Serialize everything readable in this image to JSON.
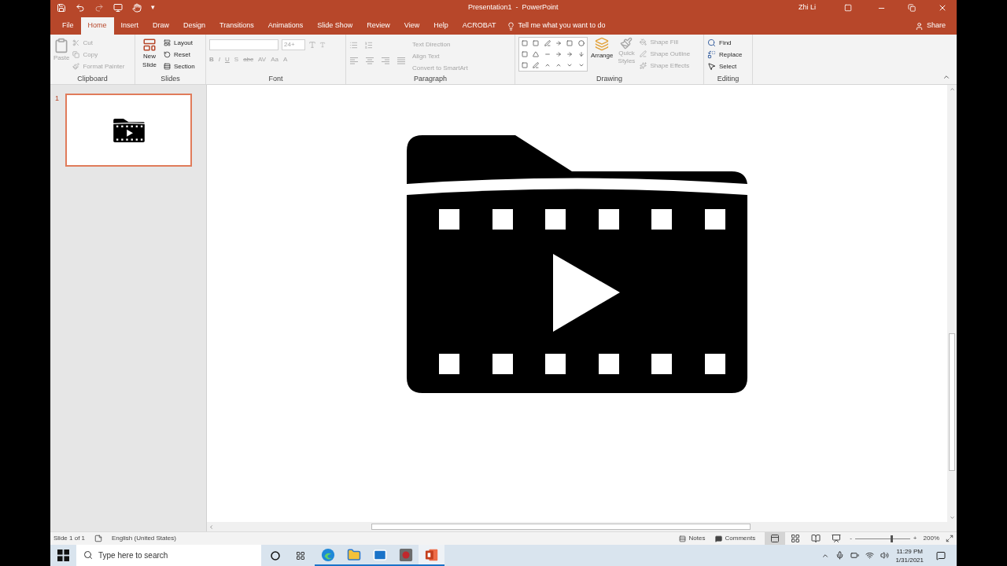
{
  "title_bar": {
    "customize": "▾",
    "title": "Presentation1  -  PowerPoint",
    "user": "Zhi Li"
  },
  "tabs": [
    {
      "label": "File",
      "selected": false
    },
    {
      "label": "Home",
      "selected": true
    },
    {
      "label": "Insert",
      "selected": false
    },
    {
      "label": "Draw",
      "selected": false
    },
    {
      "label": "Design",
      "selected": false
    },
    {
      "label": "Transitions",
      "selected": false
    },
    {
      "label": "Animations",
      "selected": false
    },
    {
      "label": "Slide Show",
      "selected": false
    },
    {
      "label": "Review",
      "selected": false
    },
    {
      "label": "View",
      "selected": false
    },
    {
      "label": "Help",
      "selected": false
    },
    {
      "label": "ACROBAT",
      "selected": false
    }
  ],
  "tell_me": "Tell me what you want to do",
  "share": "Share",
  "ribbon": {
    "clipboard": {
      "label": "Clipboard",
      "paste": {
        "label": "Paste",
        "disabled": true
      },
      "items": [
        {
          "label": "Cut",
          "disabled": true
        },
        {
          "label": "Copy",
          "disabled": true
        },
        {
          "label": "Format Painter",
          "disabled": true
        }
      ]
    },
    "slides": {
      "label": "Slides",
      "new_slide": "New Slide",
      "items": [
        {
          "label": "Layout"
        },
        {
          "label": "Reset"
        },
        {
          "label": "Section"
        }
      ]
    },
    "font": {
      "label": "Font",
      "disabled": true,
      "font_size": "24+",
      "buttons": [
        "B",
        "I",
        "U",
        "S",
        "abc",
        "AV",
        "Aa",
        "A"
      ]
    },
    "paragraph": {
      "label": "Paragraph",
      "items": [
        {
          "label": "Text Direction",
          "disabled": true
        },
        {
          "label": "Align Text",
          "disabled": true
        },
        {
          "label": "Convert to SmartArt",
          "disabled": true
        }
      ]
    },
    "drawing": {
      "label": "Drawing",
      "arrange": "Arrange",
      "quick_styles": {
        "label": "Quick Styles",
        "disabled": true
      },
      "items": [
        {
          "label": "Shape Fill",
          "disabled": true
        },
        {
          "label": "Shape Outline",
          "disabled": true
        },
        {
          "label": "Shape Effects",
          "disabled": true
        }
      ]
    },
    "editing": {
      "label": "Editing",
      "items": [
        {
          "kind": "find",
          "label": "Find"
        },
        {
          "kind": "replace",
          "label": "Replace"
        },
        {
          "kind": "select",
          "label": "Select"
        }
      ]
    }
  },
  "thumbnails": [
    {
      "number": "1",
      "selected": true
    }
  ],
  "status_bar": {
    "slide": "Slide 1 of 1",
    "language": "English (United States)",
    "notes": "Notes",
    "comments": "Comments",
    "views": [
      {
        "kind": "normal",
        "selected": true
      },
      {
        "kind": "sorter",
        "selected": false
      },
      {
        "kind": "reading",
        "selected": false
      },
      {
        "kind": "slideshow",
        "selected": false
      }
    ],
    "zoom_out": "-",
    "zoom_in": "+",
    "zoom": {
      "level": 0.66
    },
    "zoom_percent": "200%"
  },
  "taskbar": {
    "search_placeholder": "Type here to search",
    "apps": [
      {
        "kind": "edge",
        "running": true,
        "selected": false
      },
      {
        "kind": "explorer",
        "running": true,
        "selected": false
      },
      {
        "kind": "mail",
        "running": true,
        "selected": false
      },
      {
        "kind": "media",
        "running": true,
        "selected": false
      },
      {
        "kind": "powerpoint",
        "running": true,
        "selected": true
      }
    ],
    "time": "11:29 PM",
    "date": "1/31/2021"
  }
}
